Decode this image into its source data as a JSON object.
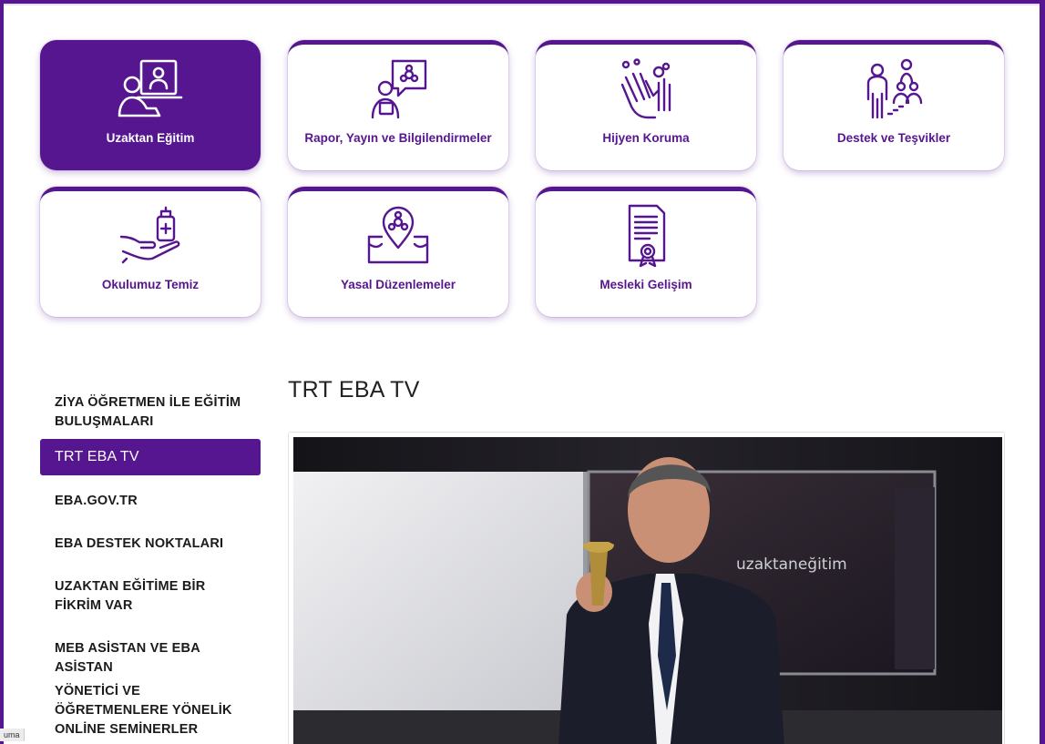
{
  "cards": [
    {
      "label": "Uzaktan Eğitim",
      "icon": "online-teacher-icon",
      "active": true
    },
    {
      "label": "Rapor, Yayın ve Bilgilendirmeler",
      "icon": "virus-report-icon",
      "active": false
    },
    {
      "label": "Hijyen Koruma",
      "icon": "hand-washing-icon",
      "active": false
    },
    {
      "label": "Destek ve Teşvikler",
      "icon": "people-support-icon",
      "active": false
    },
    {
      "label": "Okulumuz Temiz",
      "icon": "hand-sanitizer-icon",
      "active": false
    },
    {
      "label": "Yasal Düzenlemeler",
      "icon": "map-biohazard-icon",
      "active": false
    },
    {
      "label": "Mesleki Gelişim",
      "icon": "certificate-icon",
      "active": false
    }
  ],
  "sidebar": {
    "items": [
      {
        "label": "ZİYA ÖĞRETMEN İLE EĞİTİM BULUŞMALARI"
      },
      {
        "label": "TRT EBA TV",
        "active": true
      },
      {
        "label": "EBA.GOV.TR"
      },
      {
        "label": "EBA DESTEK NOKTALARI"
      },
      {
        "label": "UZAKTAN EĞİTİME BİR FİKRİM VAR"
      },
      {
        "label": "MEB ASİSTAN VE EBA ASİSTAN"
      },
      {
        "label": "YÖNETİCİ VE ÖĞRETMENLERE YÖNELİK ONLİNE SEMİNERLER"
      }
    ]
  },
  "main": {
    "title": "TRT EBA TV",
    "photo_screen_text": "uzaktaneğitim"
  },
  "taskbar": {
    "tab_fragment": "uma"
  },
  "colors": {
    "brand": "#56168f",
    "white": "#ffffff"
  }
}
